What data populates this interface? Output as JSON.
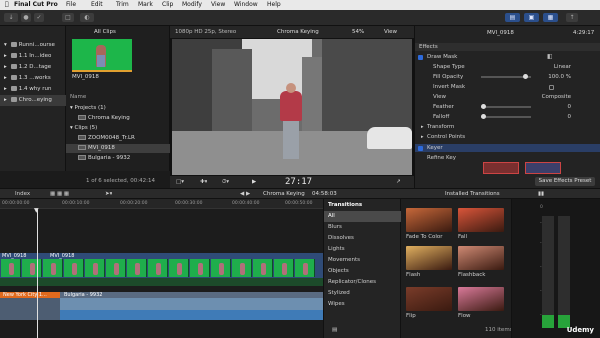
{
  "menubar": {
    "app_name": "Final Cut Pro",
    "items": [
      "File",
      "Edit",
      "Trim",
      "Mark",
      "Clip",
      "Modify",
      "View",
      "Window",
      "Help"
    ]
  },
  "library": {
    "items": [
      {
        "label": "Runni...ourse"
      },
      {
        "label": "1.1 In...ideo"
      },
      {
        "label": "1.2 D...tage"
      },
      {
        "label": "1.3 ...works"
      },
      {
        "label": "1.4 why run"
      },
      {
        "label": "Chro...eying"
      }
    ]
  },
  "browser": {
    "filter_label": "All Clips",
    "thumb_label": "MVI_0918",
    "name_header": "Name",
    "rows": [
      {
        "label": "Projects",
        "count": "(1)"
      },
      {
        "label": "Chroma Keying",
        "count": ""
      },
      {
        "label": "Clips",
        "count": "(5)"
      },
      {
        "label": "ZOOM0048_Tr.LR",
        "count": ""
      },
      {
        "label": "MVI_0918",
        "count": ""
      },
      {
        "label": "Bulgaria - 9932",
        "count": ""
      }
    ],
    "status": "1 of 6 selected, 00:42:14"
  },
  "viewer": {
    "format": "1080p HD 25p, Stereo",
    "project": "Chroma Keying",
    "zoom": "54%",
    "view_menu": "View",
    "timecode": "27:17"
  },
  "inspector": {
    "clip_name": "MVI_0918",
    "duration": "4:29:17",
    "rows": [
      {
        "label": "Effects",
        "value": "",
        "type": "header"
      },
      {
        "label": "Draw Mask",
        "value": "",
        "type": "check"
      },
      {
        "label": "Shape Type",
        "value": "Linear",
        "type": "value"
      },
      {
        "label": "Fill Opacity",
        "value": "100.0 %",
        "type": "slider"
      },
      {
        "label": "Invert Mask",
        "value": "",
        "type": "checkbox-off"
      },
      {
        "label": "View",
        "value": "Composite",
        "type": "value"
      },
      {
        "label": "Feather",
        "value": "0",
        "type": "slider"
      },
      {
        "label": "Falloff",
        "value": "0",
        "type": "slider"
      },
      {
        "label": "Transform",
        "value": "",
        "type": "disclosure"
      },
      {
        "label": "Control Points",
        "value": "",
        "type": "disclosure"
      },
      {
        "label": "Keyer",
        "value": "",
        "type": "check-selected"
      },
      {
        "label": "Refine Key",
        "value": "",
        "type": "label"
      }
    ],
    "save_button": "Save Effects Preset"
  },
  "timeline_bar": {
    "index": "Index",
    "project": "Chroma Keying",
    "duration": "04:58:03",
    "transitions_label": "Transitions",
    "installed_label": "Installed Transitions"
  },
  "timeline": {
    "ruler": [
      "00:00:00:00",
      "00:00:10:00",
      "00:00:20:00",
      "00:00:30:00",
      "00:00:40:00",
      "00:00:50:00",
      "00:01:00:00"
    ],
    "main_clip_label": "MVI_0918",
    "connected_clip_label": "New York City 1...",
    "storyline_clip_label": "Bulgaria - 9932"
  },
  "transitions": {
    "categories": [
      "Transitions",
      "All",
      "Blurs",
      "Dissolves",
      "Lights",
      "Movements",
      "Objects",
      "Replicator/Clones",
      "Stylized",
      "Wipes"
    ],
    "count": "110 items",
    "items": [
      {
        "name": "Fade To Color",
        "color": "#c7683a"
      },
      {
        "name": "Fall",
        "color": "#d9553a"
      },
      {
        "name": "Flash",
        "color": "#e0b060"
      },
      {
        "name": "Flashback",
        "color": "#cf8a74"
      },
      {
        "name": "Flip",
        "color": "#7a3c2a"
      },
      {
        "name": "Flow",
        "color": "#d97a9a"
      }
    ]
  },
  "meters": {
    "scale": [
      "0",
      "-6",
      "-12",
      "-20",
      "-30",
      "-50"
    ],
    "levels": [
      0.12,
      0.12
    ]
  },
  "watermark": "Udemy",
  "colors": {
    "accent": "#2d6adb",
    "clip_green": "#1fae4c",
    "storyline_blue": "#2f4b77"
  }
}
